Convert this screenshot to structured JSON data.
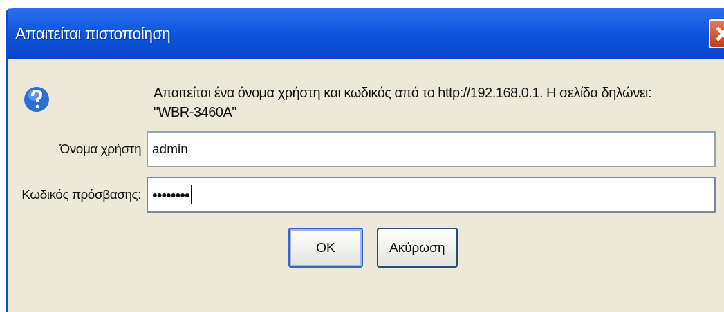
{
  "window": {
    "title": "Απαιτείται πιστοποίηση"
  },
  "message": "Απαιτείται ένα όνομα χρήστη και κωδικός από το http://192.168.0.1. Η σελίδα δηλώνει: \"WBR-3460A\"",
  "fields": [
    {
      "kind": "text",
      "label": "Όνομα χρήστη",
      "value": "admin",
      "focused": false
    },
    {
      "kind": "password",
      "label": "Κωδικός πρόσβασης:",
      "value": "••••••••",
      "focused": true
    }
  ],
  "buttons": [
    {
      "label": "OK",
      "default": true
    },
    {
      "label": "Ακύρωση",
      "default": false
    }
  ]
}
